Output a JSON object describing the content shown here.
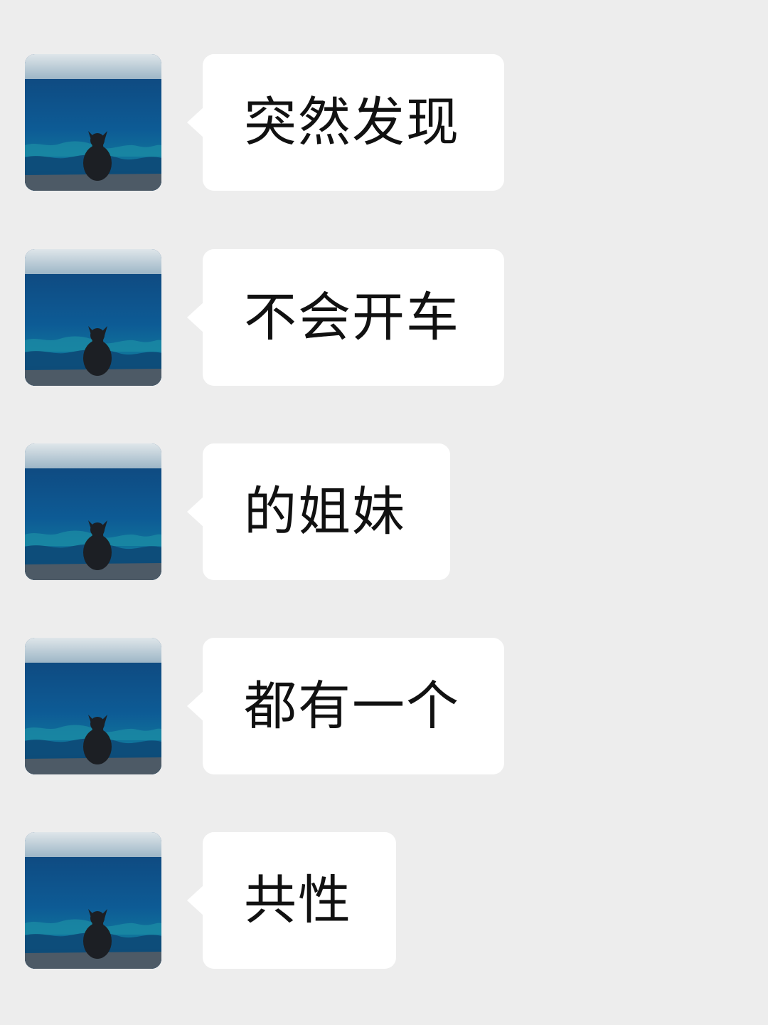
{
  "chat": {
    "messages": [
      {
        "text": "突然发现",
        "avatar_icon": "cat-by-sea-avatar-icon"
      },
      {
        "text": "不会开车",
        "avatar_icon": "cat-by-sea-avatar-icon"
      },
      {
        "text": "的姐妹",
        "avatar_icon": "cat-by-sea-avatar-icon"
      },
      {
        "text": "都有一个",
        "avatar_icon": "cat-by-sea-avatar-icon"
      },
      {
        "text": "共性",
        "avatar_icon": "cat-by-sea-avatar-icon"
      }
    ]
  },
  "colors": {
    "background": "#ededed",
    "bubble": "#ffffff",
    "text": "#111111"
  }
}
